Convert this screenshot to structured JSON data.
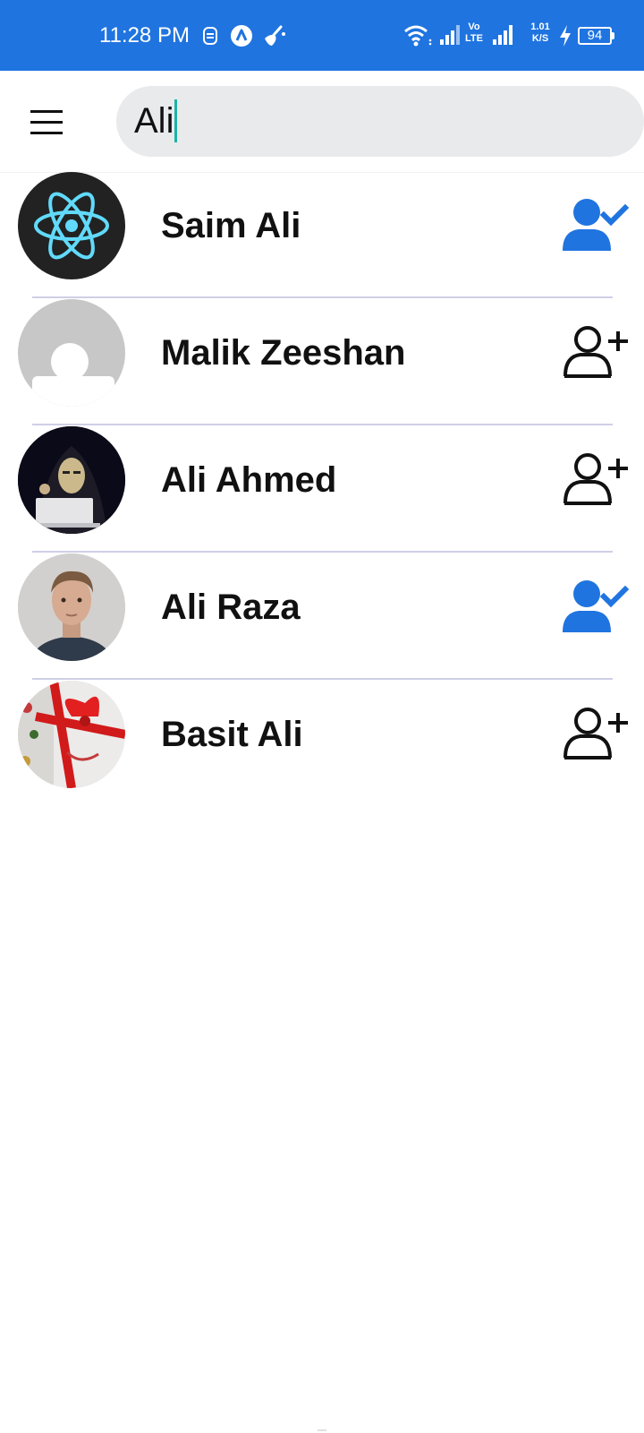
{
  "status_bar": {
    "time": "11:28 PM",
    "network_speed_value": "1.01",
    "network_speed_unit": "K/S",
    "volte_top": "Vo",
    "volte_bottom": "LTE",
    "battery_level": "94",
    "color": "#1f74e0"
  },
  "header": {
    "menu_icon": "hamburger-menu-icon",
    "search": {
      "value": "Ali",
      "placeholder": ""
    }
  },
  "contacts": [
    {
      "name": "Saim Ali",
      "avatar": "react-logo",
      "status": "friend",
      "action_icon": "user-check-icon"
    },
    {
      "name": "Malik Zeeshan",
      "avatar": "default-avatar",
      "status": "not-friend",
      "action_icon": "user-plus-icon"
    },
    {
      "name": "Ali Ahmed",
      "avatar": "hooded-figure-photo",
      "status": "not-friend",
      "action_icon": "user-plus-icon"
    },
    {
      "name": "Ali Raza",
      "avatar": "man-portrait-photo",
      "status": "friend",
      "action_icon": "user-check-icon"
    },
    {
      "name": "Basit Ali",
      "avatar": "gift-wrap-photo",
      "status": "not-friend",
      "action_icon": "user-plus-icon"
    }
  ],
  "colors": {
    "accent": "#1f74e0",
    "search_bg": "#e9eaec",
    "caret": "#1bb3a6",
    "divider": "#cfcfe6"
  }
}
